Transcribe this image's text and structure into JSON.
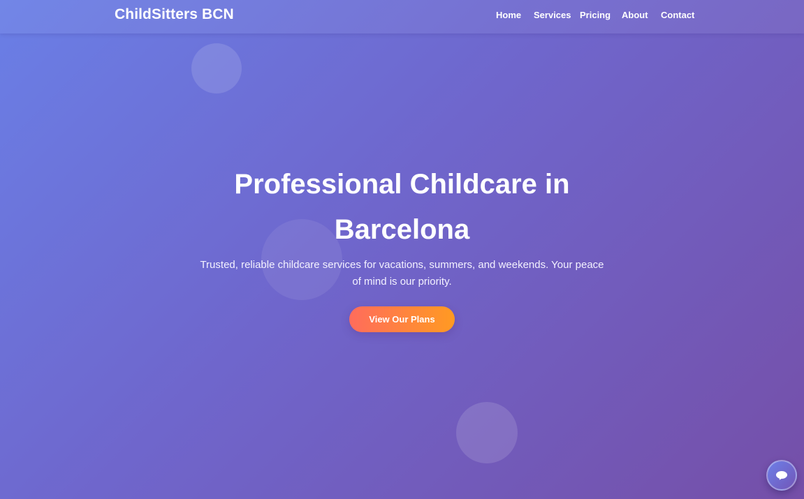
{
  "header": {
    "logo": "ChildSitters BCN",
    "nav": [
      {
        "label": "Home"
      },
      {
        "label": "Services"
      },
      {
        "label": "Pricing"
      },
      {
        "label": "About"
      },
      {
        "label": "Contact"
      }
    ]
  },
  "hero": {
    "title": "Professional Childcare in Barcelona",
    "subtitle": "Trusted, reliable childcare services for vacations, summers, and weekends. Your peace of mind is our priority.",
    "cta_label": "View Our Plans"
  },
  "chat_widget": {
    "icon": "chat-bubble-icon"
  },
  "colors": {
    "background_start": "#6a7fe6",
    "background_end": "#754fa8",
    "cta_start": "#ff6c5c",
    "cta_end": "#ff9a22"
  }
}
